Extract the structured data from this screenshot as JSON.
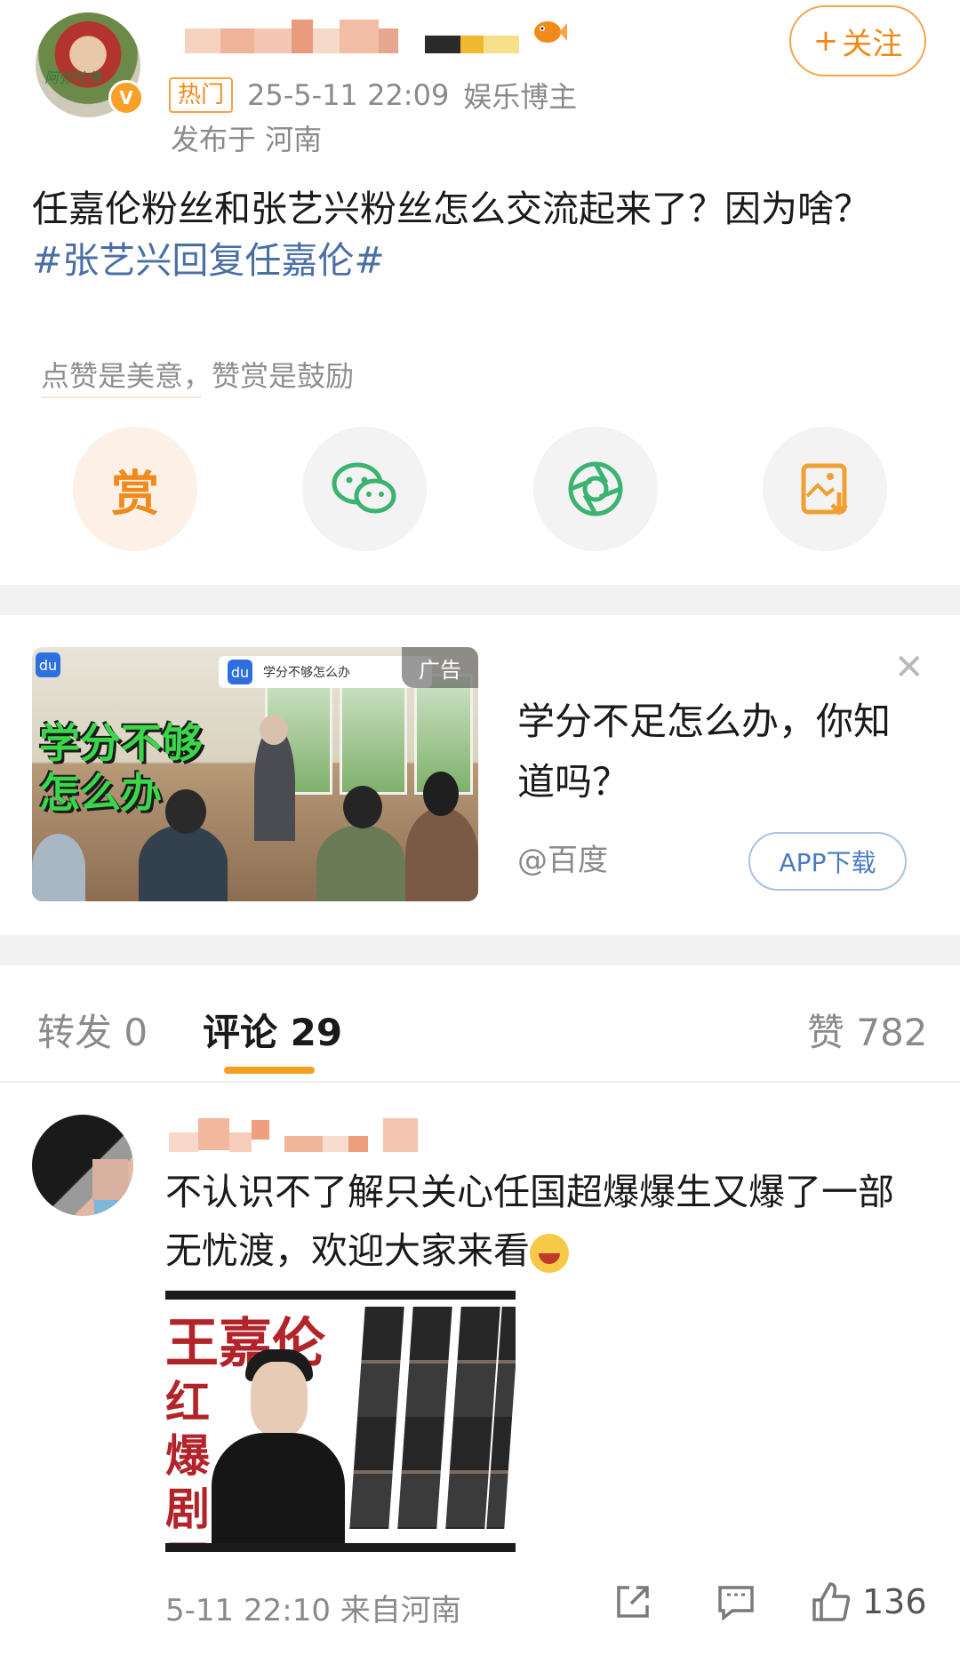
{
  "post": {
    "follow_label": "关注",
    "hot_badge": "热门",
    "timestamp": "25-5-11 22:09",
    "author_type": "娱乐博主",
    "location": "发布于 河南",
    "text": "任嘉伦粉丝和张艺兴粉丝怎么交流起来了？因为啥？",
    "hashtag": "#张艺兴回复任嘉伦#",
    "avatar_text": "阿弥陀佛"
  },
  "reward": {
    "hint": "点赞是美意，赞赏是鼓励",
    "reward_label": "赏"
  },
  "ad": {
    "headline_line1": "学分不够",
    "headline_line2": "怎么办",
    "searchbar_text": "学分不够怎么办",
    "tag": "广告",
    "title": "学分不足怎么办，你知道吗？",
    "source": "@百度",
    "button": "APP下载"
  },
  "tabs": {
    "repost": "转发 0",
    "comments": "评论 29",
    "likes": "赞 782"
  },
  "comment": {
    "text": "不认识不了解只关心任国超爆爆生又爆了一部无忧渡，欢迎大家来看",
    "image_title": "王嘉伦",
    "image_side": "红爆剧王",
    "footer": "5-11 22:10 来自河南",
    "like_count": "136"
  },
  "colors": {
    "accent_orange": "#f08a1a",
    "hashtag_blue": "#4a6fa5",
    "tab_underline": "#f5a023"
  },
  "icons": [
    "plus-icon",
    "verified-badge-icon",
    "fish-icon",
    "wechat-icon",
    "moments-icon",
    "save-image-icon",
    "close-icon",
    "share-icon",
    "comment-icon",
    "like-icon",
    "baidu-icon"
  ]
}
